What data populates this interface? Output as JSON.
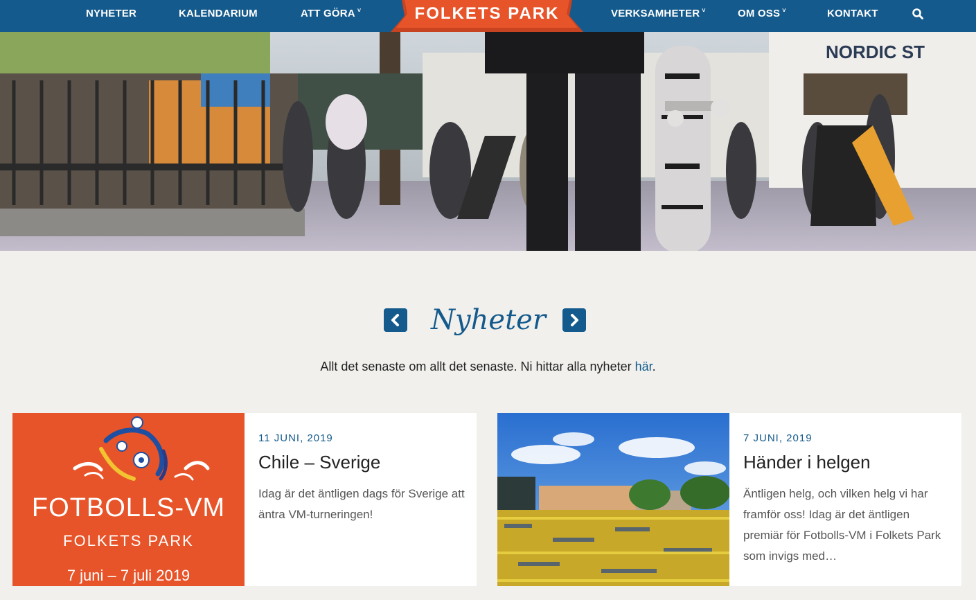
{
  "nav": {
    "items": [
      {
        "label": "NYHETER"
      },
      {
        "label": "KALENDARIUM"
      },
      {
        "label": "ATT GÖRA"
      },
      {
        "label": "VERKSAMHETER"
      },
      {
        "label": "OM OSS"
      },
      {
        "label": "KONTAKT"
      }
    ],
    "logo": "FOLKETS PARK"
  },
  "hero": {
    "sign_text": "NORDIC ST"
  },
  "section": {
    "title": "Nyheter",
    "subtitle": "Allt det senaste om allt det senaste. Ni hittar alla nyheter ",
    "subtitle_link": "här",
    "subtitle_end": "."
  },
  "cards": [
    {
      "date": "11 JUNI, 2019",
      "title": "Chile – Sverige",
      "excerpt": "Idag är det äntligen dags för Sverige att äntra VM-turneringen!",
      "image_title": "FOTBOLLS-VM",
      "image_subtitle": "FOLKETS PARK",
      "image_dates": "7 juni – 7 juli 2019"
    },
    {
      "date": "7 JUNI, 2019",
      "title": "Händer i helgen",
      "excerpt": "Äntligen helg, och vilken helg vi har framför oss! Idag är det äntligen premiär för Fotbolls-VM i Folkets Park som invigs med…"
    }
  ],
  "colors": {
    "nav_blue": "#145a8c",
    "logo_orange": "#e8542a",
    "background": "#f1f0ed"
  }
}
